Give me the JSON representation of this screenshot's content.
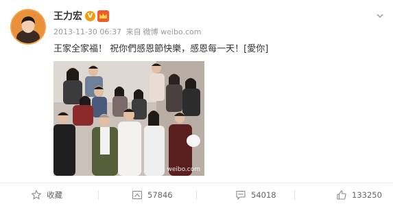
{
  "post": {
    "author": "王力宏",
    "verified_badge": "V",
    "timestamp": "2013-11-30 06:37",
    "source_prefix": "来自",
    "source": "微博 weibo.com",
    "text": "王家全家福！ 祝你們感恩節快樂，感恩每一天！[愛你]",
    "image_watermark": "weibo.com"
  },
  "actions": {
    "favorite_label": "收藏",
    "repost_count": "57846",
    "comment_count": "54018",
    "like_count": "133250"
  },
  "icons": [
    "avatar",
    "verified-badge-icon",
    "crown-icon",
    "chevron-down-icon",
    "star-icon",
    "repost-icon",
    "comment-icon",
    "thumbs-up-icon"
  ],
  "colors": {
    "accent_orange": "#f39c12",
    "meta_gray": "#999999",
    "text": "#333333"
  }
}
